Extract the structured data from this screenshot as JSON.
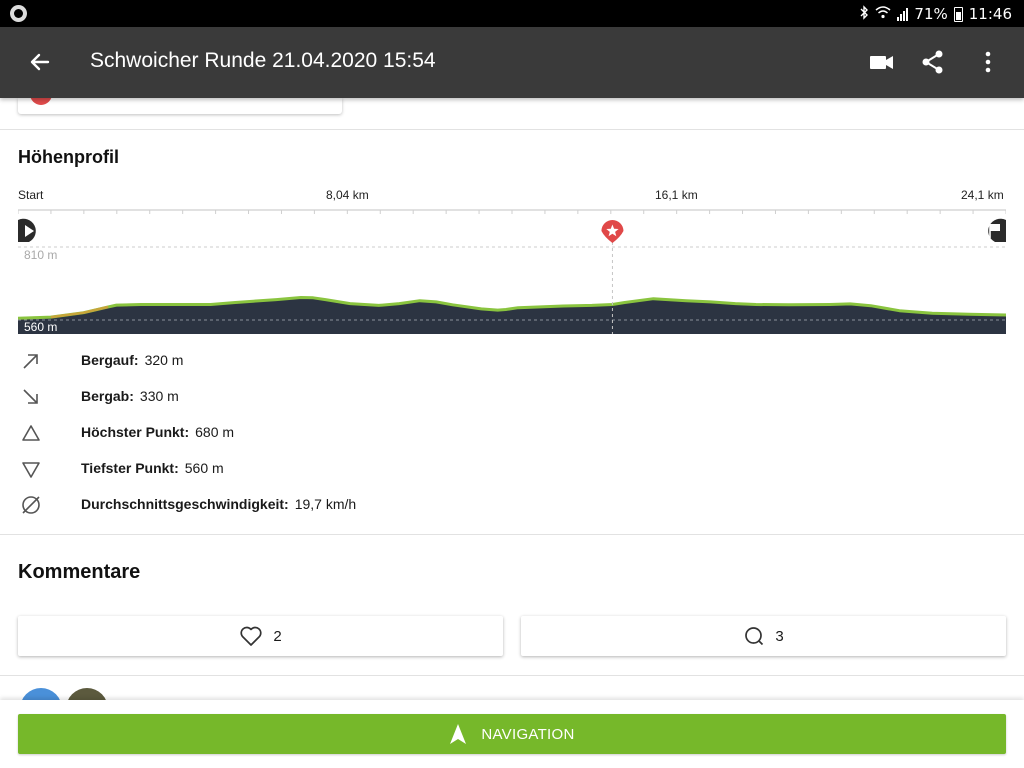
{
  "status_bar": {
    "battery": "71%",
    "time": "11:46",
    "icons": [
      "bluetooth-icon",
      "wifi-icon",
      "signal-icon",
      "battery-icon"
    ]
  },
  "app_bar": {
    "title": "Schwoicher Runde 21.04.2020 15:54",
    "actions": [
      "video-icon",
      "share-icon",
      "more-icon"
    ]
  },
  "elevation": {
    "title": "Höhenprofil",
    "axis_labels": {
      "start": "Start",
      "km1": "8,04 km",
      "km2": "16,1 km",
      "km3": "24,1 km"
    },
    "y_max_label": "810 m",
    "y_min_label": "560 m"
  },
  "chart_data": {
    "type": "area",
    "title": "Höhenprofil",
    "xlabel": "",
    "ylabel": "",
    "x_ticks": [
      "Start",
      "8,04 km",
      "16,1 km",
      "24,1 km"
    ],
    "xlim": [
      0,
      24.1
    ],
    "ylim": [
      560,
      810
    ],
    "x": [
      0,
      0.8,
      1.6,
      2.2,
      2.4,
      3.0,
      3.9,
      4.7,
      5.3,
      6.3,
      6.9,
      7.2,
      7.5,
      8.1,
      8.8,
      9.3,
      9.8,
      10.2,
      10.6,
      11.3,
      11.7,
      11.9,
      12.2,
      13.3,
      14.0,
      14.5,
      14.8,
      15.5,
      16.3,
      16.9,
      17.5,
      18.0,
      18.8,
      19.8,
      20.3,
      20.8,
      21.5,
      22.3,
      23.2,
      24.1
    ],
    "y": [
      566,
      570,
      585,
      605,
      611,
      613,
      613,
      613,
      620,
      630,
      637,
      636,
      630,
      616,
      610,
      616,
      626,
      622,
      612,
      598,
      594,
      596,
      602,
      608,
      610,
      613,
      620,
      633,
      626,
      622,
      616,
      613,
      612,
      613,
      615,
      609,
      592,
      583,
      580,
      577
    ],
    "star_marker_km": 14.5,
    "grid": true,
    "colors": {
      "fill": "#2c3442",
      "line": "#8ac43f",
      "climb": "#c8a43a"
    }
  },
  "stats": [
    {
      "icon": "arrow-up-right-icon",
      "label": "Bergauf:",
      "value": "320 m"
    },
    {
      "icon": "arrow-down-right-icon",
      "label": "Bergab:",
      "value": "330 m"
    },
    {
      "icon": "triangle-up-icon",
      "label": "Höchster Punkt:",
      "value": "680 m"
    },
    {
      "icon": "triangle-down-icon",
      "label": "Tiefster Punkt:",
      "value": "560 m"
    },
    {
      "icon": "average-icon",
      "label": "Durchschnittsgeschwindigkeit:",
      "value": "19,7 km/h"
    }
  ],
  "comments": {
    "title": "Kommentare",
    "likes": "2",
    "comments_count": "3"
  },
  "navigation": {
    "label": "NAVIGATION",
    "color": "#76b82a"
  }
}
